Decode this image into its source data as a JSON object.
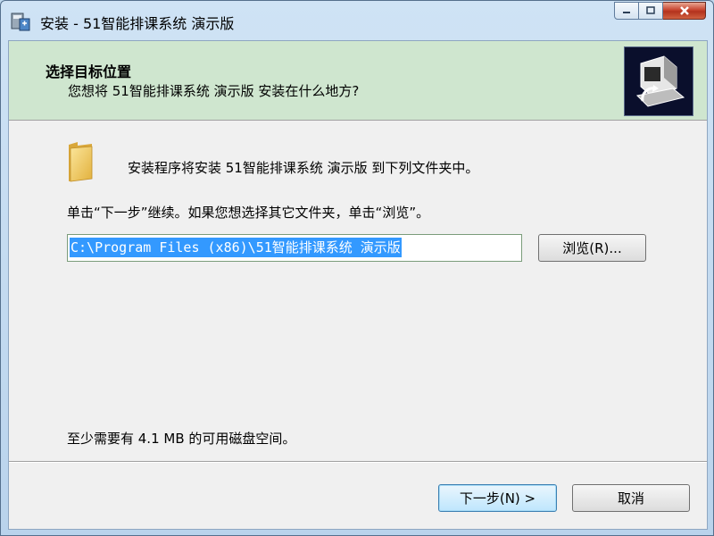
{
  "window": {
    "title": "安装 - 51智能排课系统 演示版",
    "controls": {
      "minimize_icon": "minimize-icon",
      "maximize_icon": "maximize-icon",
      "close_icon": "close-icon"
    }
  },
  "header": {
    "title": "选择目标位置",
    "subtitle": "您想将 51智能排课系统 演示版 安装在什么地方?"
  },
  "body": {
    "folder_text": "安装程序将安装 51智能排课系统 演示版 到下列文件夹中。",
    "instruction": "单击“下一步”继续。如果您想选择其它文件夹，单击“浏览”。",
    "path_value": "C:\\Program Files (x86)\\51智能排课系统 演示版",
    "browse_label": "浏览(R)...",
    "space_required": "至少需要有 4.1 MB 的可用磁盘空间。"
  },
  "footer": {
    "next_label": "下一步(N) >",
    "cancel_label": "取消"
  },
  "colors": {
    "header_bg": "#cfe6cf",
    "selection": "#3399ff",
    "close_button": "#c7452f"
  }
}
